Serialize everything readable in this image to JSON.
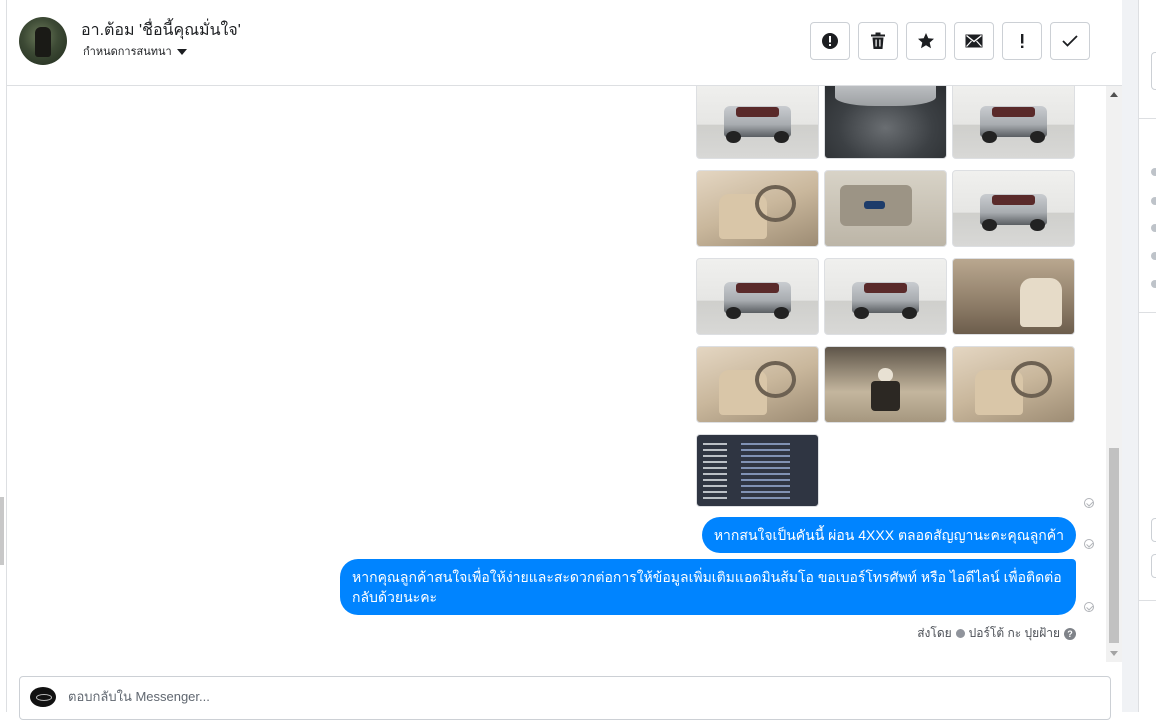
{
  "conversation": {
    "contact_name": "อา.ต้อม 'ชื่อนี้คุณมั่นใจ'",
    "assign_label": "กำหนดการสนทนา"
  },
  "toolbar": {
    "buttons": [
      {
        "id": "report",
        "icon": "alert-circle-icon"
      },
      {
        "id": "delete",
        "icon": "trash-icon"
      },
      {
        "id": "star",
        "icon": "star-icon"
      },
      {
        "id": "mark-unread",
        "icon": "envelope-icon"
      },
      {
        "id": "important",
        "icon": "exclamation-icon"
      },
      {
        "id": "done",
        "icon": "checkmark-icon"
      }
    ]
  },
  "messages": {
    "photo_grid": [
      "car-exterior-front",
      "engine-bay",
      "car-exterior-front",
      "car-interior-driver",
      "door-panel",
      "car-exterior-front",
      "car-exterior-front",
      "car-exterior-front",
      "car-cabin-seat",
      "car-interior-driver",
      "gear-shifter",
      "car-interior-driver",
      "vehicle-registration-document"
    ],
    "bubble_1": "หากสนใจเป็นคันนี้ ผ่อน 4XXX ตลอดสัญญานะคะคุณลูกค้า",
    "bubble_2": "หากคุณลูกค้าสนใจเพื่อให้ง่ายและสะดวกต่อการให้ข้อมูลเพิ่มเติมแอดมินส้มโอ ขอเบอร์โทรศัพท์ หรือ ไอดีไลน์ เพื่อติดต่อกลับด้วยนะคะ",
    "sent_by_prefix": "ส่งโดย",
    "sent_by_name": "ปอร์โต้ กะ ปุยฝ้าย",
    "help_icon_text": "?"
  },
  "composer": {
    "placeholder": "ตอบกลับใน Messenger..."
  },
  "colors": {
    "bubble": "#0084ff",
    "border": "#dddfe2"
  }
}
